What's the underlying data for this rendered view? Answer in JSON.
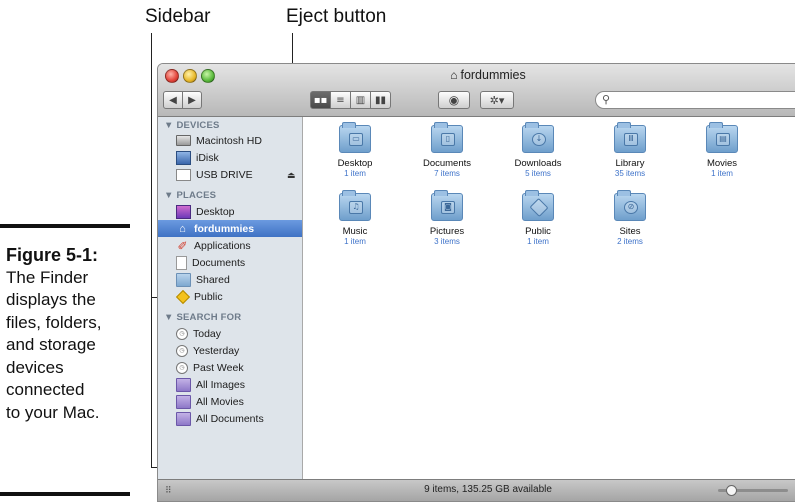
{
  "callouts": {
    "sidebar": "Sidebar",
    "eject": "Eject button"
  },
  "caption": {
    "number": "Figure 5-1:",
    "lines": [
      "The Finder",
      "displays the",
      "files, folders,",
      "and storage",
      "devices",
      "connected",
      "to your Mac."
    ]
  },
  "window": {
    "title": "fordummies",
    "search_value": ""
  },
  "sidebar": {
    "devices_heading": "▼ DEVICES",
    "devices": [
      {
        "label": "Macintosh HD",
        "icon": "hard-drive-icon"
      },
      {
        "label": "iDisk",
        "icon": "idisk-icon"
      },
      {
        "label": "USB DRIVE",
        "icon": "usb-drive-icon"
      }
    ],
    "places_heading": "▼ PLACES",
    "places": [
      {
        "label": "Desktop",
        "icon": "desktop-icon"
      },
      {
        "label": "fordummies",
        "icon": "home-icon",
        "selected": true
      },
      {
        "label": "Applications",
        "icon": "applications-icon"
      },
      {
        "label": "Documents",
        "icon": "document-icon"
      },
      {
        "label": "Shared",
        "icon": "folder-icon"
      },
      {
        "label": "Public",
        "icon": "public-icon"
      }
    ],
    "search_heading": "▼ SEARCH FOR",
    "searches": [
      {
        "label": "Today",
        "icon": "clock-icon"
      },
      {
        "label": "Yesterday",
        "icon": "clock-icon"
      },
      {
        "label": "Past Week",
        "icon": "clock-icon"
      },
      {
        "label": "All Images",
        "icon": "smart-folder-icon"
      },
      {
        "label": "All Movies",
        "icon": "smart-folder-icon"
      },
      {
        "label": "All Documents",
        "icon": "smart-folder-icon"
      }
    ]
  },
  "folders": [
    {
      "name": "Desktop",
      "count": "1 item",
      "icon": "desktop-folder-icon"
    },
    {
      "name": "Documents",
      "count": "7 items",
      "icon": "documents-folder-icon"
    },
    {
      "name": "Downloads",
      "count": "5 items",
      "icon": "downloads-folder-icon"
    },
    {
      "name": "Library",
      "count": "35 items",
      "icon": "library-folder-icon"
    },
    {
      "name": "Movies",
      "count": "1 item",
      "icon": "movies-folder-icon"
    },
    {
      "name": "Music",
      "count": "1 item",
      "icon": "music-folder-icon"
    },
    {
      "name": "Pictures",
      "count": "3 items",
      "icon": "pictures-folder-icon"
    },
    {
      "name": "Public",
      "count": "1 item",
      "icon": "public-folder-icon"
    },
    {
      "name": "Sites",
      "count": "2 items",
      "icon": "sites-folder-icon"
    }
  ],
  "status": {
    "text": "9 items, 135.25 GB available"
  }
}
